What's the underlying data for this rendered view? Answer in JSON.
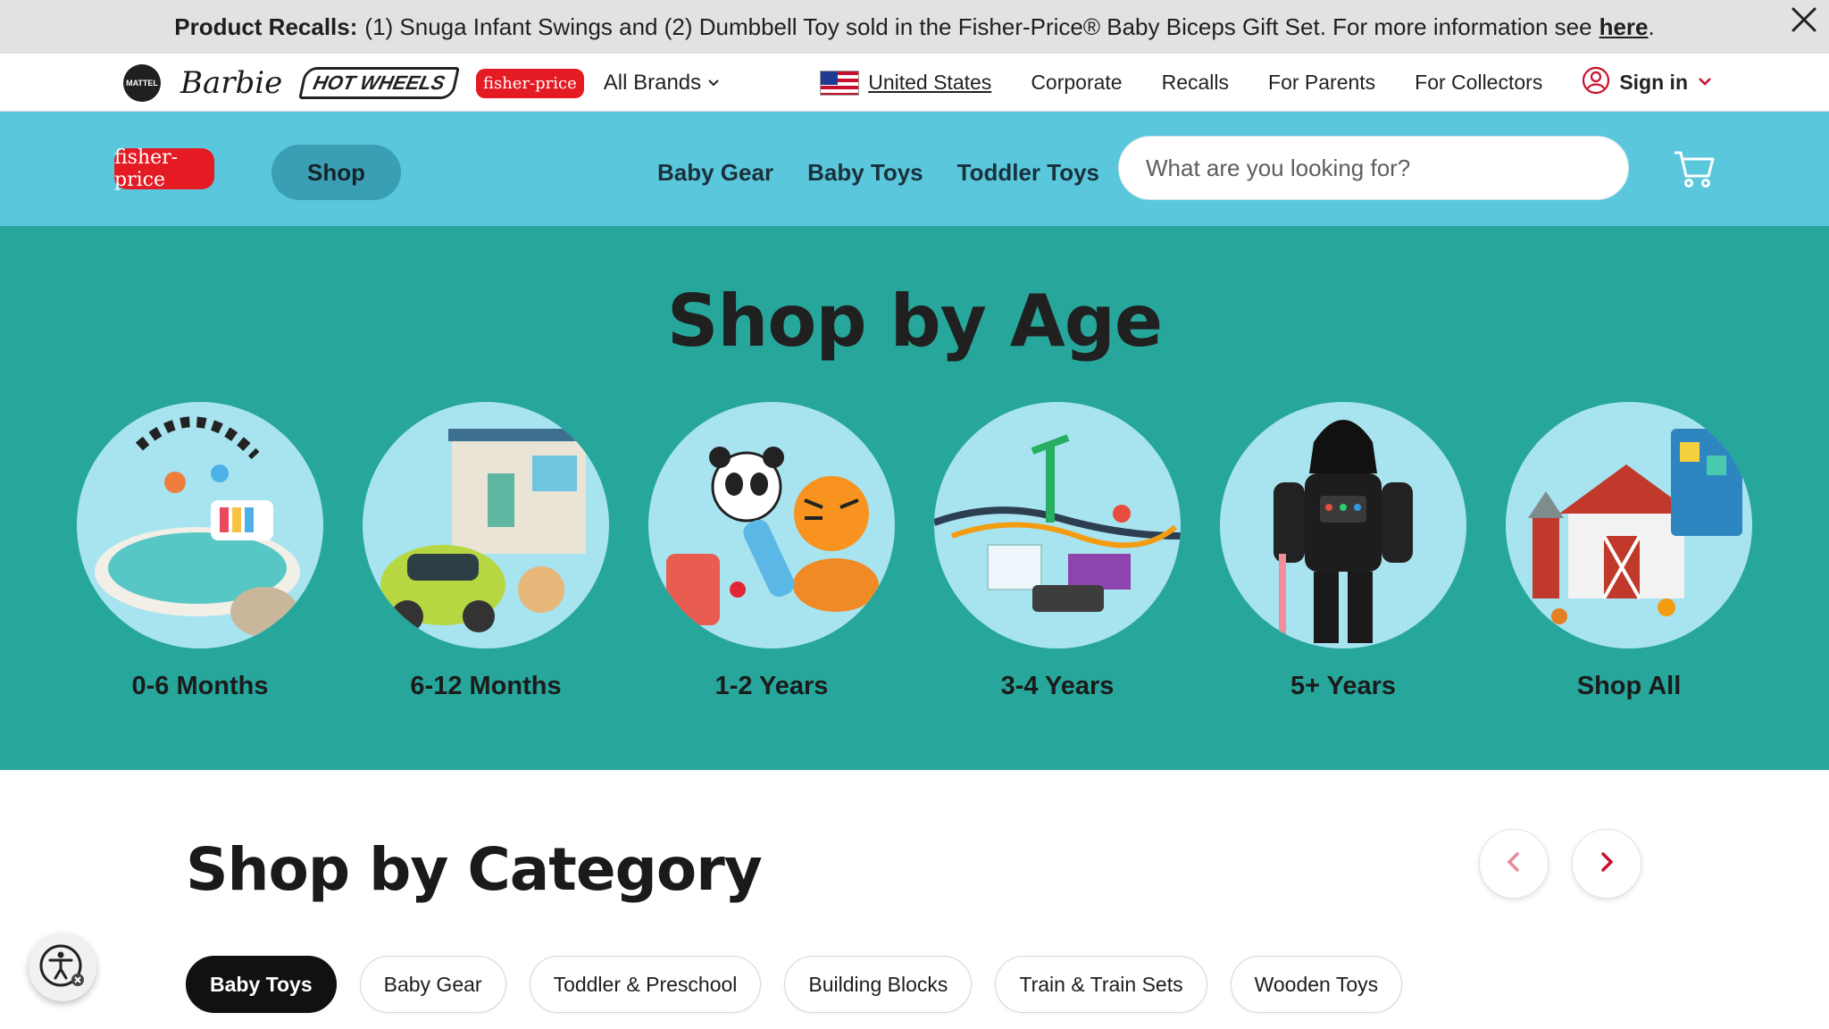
{
  "recall": {
    "label": "Product Recalls:",
    "message": "(1) Snuga Infant Swings and (2) Dumbbell Toy sold in the Fisher-Price® Baby Biceps Gift Set. For more information see",
    "link": "here",
    "end": "."
  },
  "brands": {
    "mattel": "MATTEL",
    "barbie": "Barbie",
    "hotwheels": "HOT WHEELS",
    "fisherprice": "fisher-price",
    "all_brands": "All Brands"
  },
  "util_nav": {
    "country": "United States",
    "links": [
      "Corporate",
      "Recalls",
      "For Parents",
      "For Collectors"
    ],
    "signin": "Sign in"
  },
  "header": {
    "logo": "fisher-price",
    "shop": "Shop",
    "nav": [
      "Baby Gear",
      "Baby Toys",
      "Toddler Toys"
    ],
    "search_placeholder": "What are you looking for?"
  },
  "age_section": {
    "title": "Shop by Age",
    "items": [
      "0-6 Months",
      "6-12 Months",
      "1-2 Years",
      "3-4 Years",
      "5+ Years",
      "Shop All"
    ]
  },
  "category_section": {
    "title": "Shop by Category",
    "chips": [
      "Baby Toys",
      "Baby Gear",
      "Toddler & Preschool",
      "Building Blocks",
      "Train & Train Sets",
      "Wooden Toys"
    ]
  },
  "colors": {
    "header_blue": "#5ac7dc",
    "age_teal": "#27a69b",
    "circle_blue": "#a8e3f0",
    "brand_red": "#e51b23",
    "accent_red": "#c8102e"
  }
}
